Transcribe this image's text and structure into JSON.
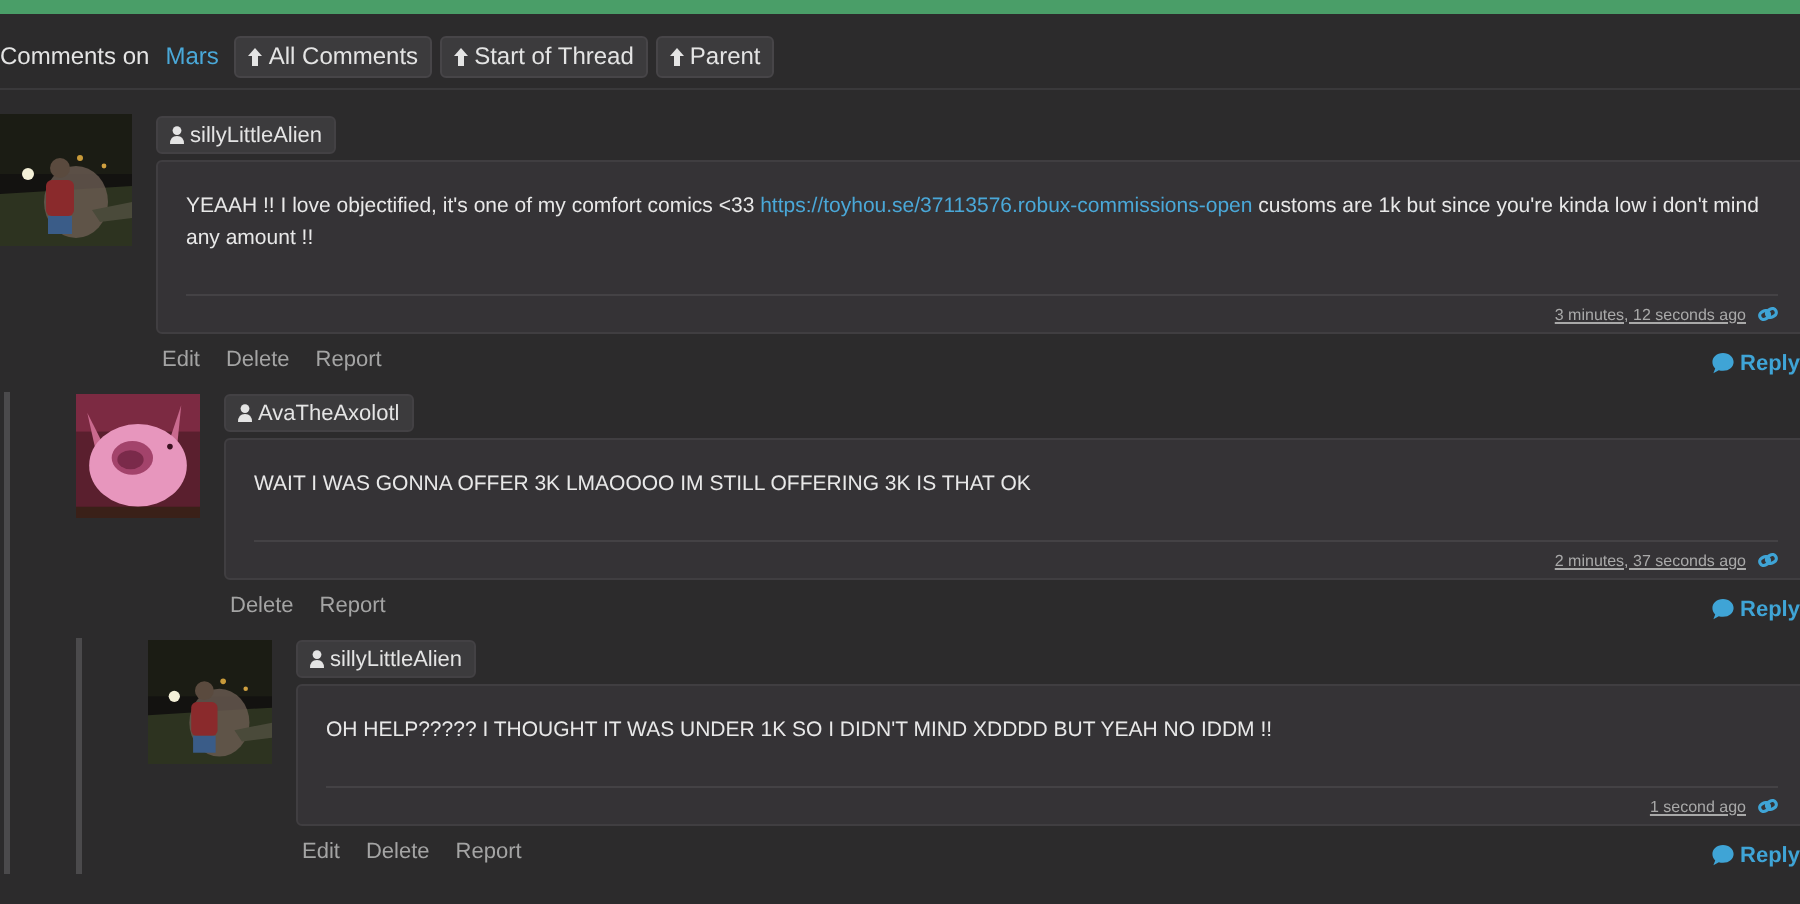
{
  "header": {
    "prefix": "Comments on",
    "link": "Mars",
    "buttons": [
      {
        "label": "All Comments"
      },
      {
        "label": "Start of Thread"
      },
      {
        "label": "Parent"
      }
    ]
  },
  "comments": [
    {
      "username": "sillyLittleAlien",
      "avatar": {
        "kind": "picture"
      },
      "parts": [
        {
          "kind": "text",
          "text": "YEAAH !! I love objectified, it's one of my comfort comics <33 "
        },
        {
          "kind": "link",
          "text": "https://toyhou.se/37113576.robux-commissions-open"
        },
        {
          "kind": "text",
          "text": " customs are 1k but since you're kinda low i don't mind any amount !!"
        }
      ],
      "timestamp": "3 minutes, 12 seconds ago",
      "actions": [
        "Edit",
        "Delete",
        "Report"
      ],
      "reply": "Reply",
      "children": [
        {
          "username": "AvaTheAxolotl",
          "avatar": {
            "kind": "picture"
          },
          "parts": [
            {
              "kind": "text",
              "text": "WAIT I WAS GONNA OFFER 3K LMAOOOO IM STILL OFFERING 3K IS THAT OK"
            }
          ],
          "timestamp": "2 minutes, 37 seconds ago",
          "actions": [
            "Delete",
            "Report"
          ],
          "reply": "Reply",
          "children": [
            {
              "username": "sillyLittleAlien",
              "avatar": {
                "kind": "picture"
              },
              "parts": [
                {
                  "kind": "text",
                  "text": "OH HELP????? I THOUGHT IT WAS UNDER 1K SO I DIDN'T MIND XDDDD BUT YEAH NO IDDM !!"
                }
              ],
              "timestamp": "1 second ago",
              "actions": [
                "Edit",
                "Delete",
                "Report"
              ],
              "reply": "Reply"
            }
          ]
        }
      ]
    }
  ]
}
